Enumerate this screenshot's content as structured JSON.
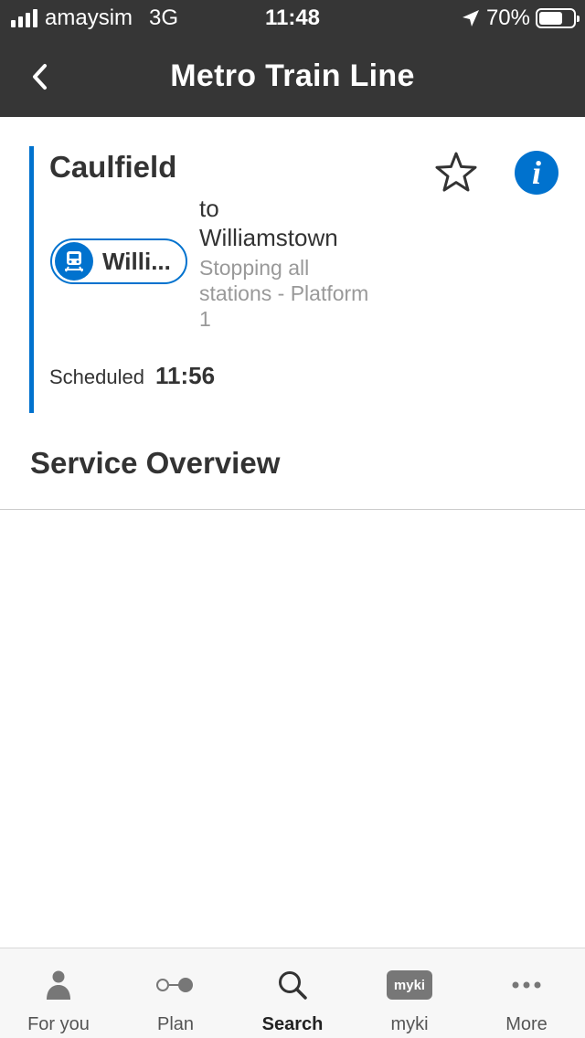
{
  "status_bar": {
    "carrier": "amaysim",
    "network": "3G",
    "time": "11:48",
    "battery": "70%",
    "battery_level": 0.7
  },
  "header": {
    "title": "Metro Train Line",
    "back_icon": "chevron-left-icon"
  },
  "departure": {
    "origin": "Caulfield",
    "route_badge": "Willi...",
    "to_label": "to",
    "destination": "Williamstown",
    "pattern": "Stopping all stations - Platform 1",
    "scheduled_label": "Scheduled",
    "scheduled_time": "11:56"
  },
  "section": {
    "title": "Service Overview"
  },
  "tabbar": {
    "items": [
      {
        "label": "For you",
        "icon": "person-icon",
        "active": false
      },
      {
        "label": "Plan",
        "icon": "plan-icon",
        "active": false
      },
      {
        "label": "Search",
        "icon": "search-icon",
        "active": true
      },
      {
        "label": "myki",
        "icon": "myki-icon",
        "icon_text": "myki",
        "active": false
      },
      {
        "label": "More",
        "icon": "more-icon",
        "active": false
      }
    ]
  },
  "colors": {
    "header_bg": "#363636",
    "accent": "#0072ce",
    "text": "#333333",
    "secondary_text": "#999999"
  }
}
